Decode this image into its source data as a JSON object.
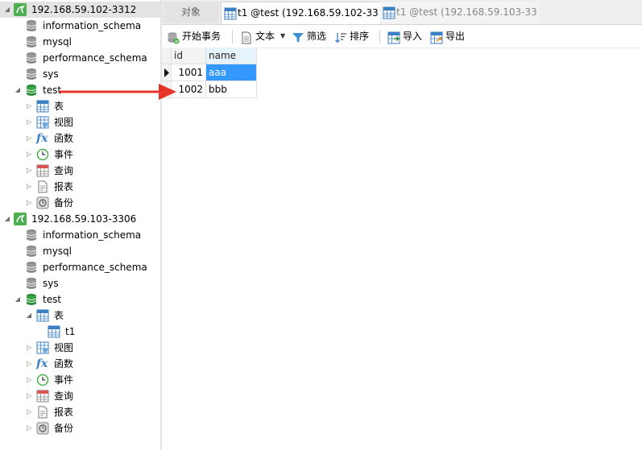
{
  "tree": {
    "conn1": {
      "label": "192.168.59.102-3312"
    },
    "conn1_dbs": [
      "information_schema",
      "mysql",
      "performance_schema",
      "sys"
    ],
    "conn1_test": {
      "label": "test",
      "nodes": [
        "表",
        "视图",
        "函数",
        "事件",
        "查询",
        "报表",
        "备份"
      ]
    },
    "conn2": {
      "label": "192.168.59.103-3306"
    },
    "conn2_dbs": [
      "information_schema",
      "mysql",
      "performance_schema",
      "sys"
    ],
    "conn2_test": {
      "label": "test",
      "table_node": "表",
      "table_child": "t1",
      "nodes": [
        "视图",
        "函数",
        "事件",
        "查询",
        "报表",
        "备份"
      ]
    }
  },
  "tabs": [
    {
      "label": "对象"
    },
    {
      "label": "t1 @test (192.168.59.102-33..."
    },
    {
      "label": "t1 @test (192.168.59.103-33..."
    }
  ],
  "toolbar": {
    "begin_txn": "开始事务",
    "text": "文本",
    "filter": "筛选",
    "sort": "排序",
    "import": "导入",
    "export": "导出"
  },
  "grid": {
    "columns": [
      "id",
      "name"
    ],
    "rows": [
      [
        "1001",
        "aaa"
      ],
      [
        "1002",
        "bbb"
      ]
    ]
  },
  "colors": {
    "accent": "#3399ff",
    "arrow": "#e8332a",
    "db_active": "#2ea043"
  }
}
